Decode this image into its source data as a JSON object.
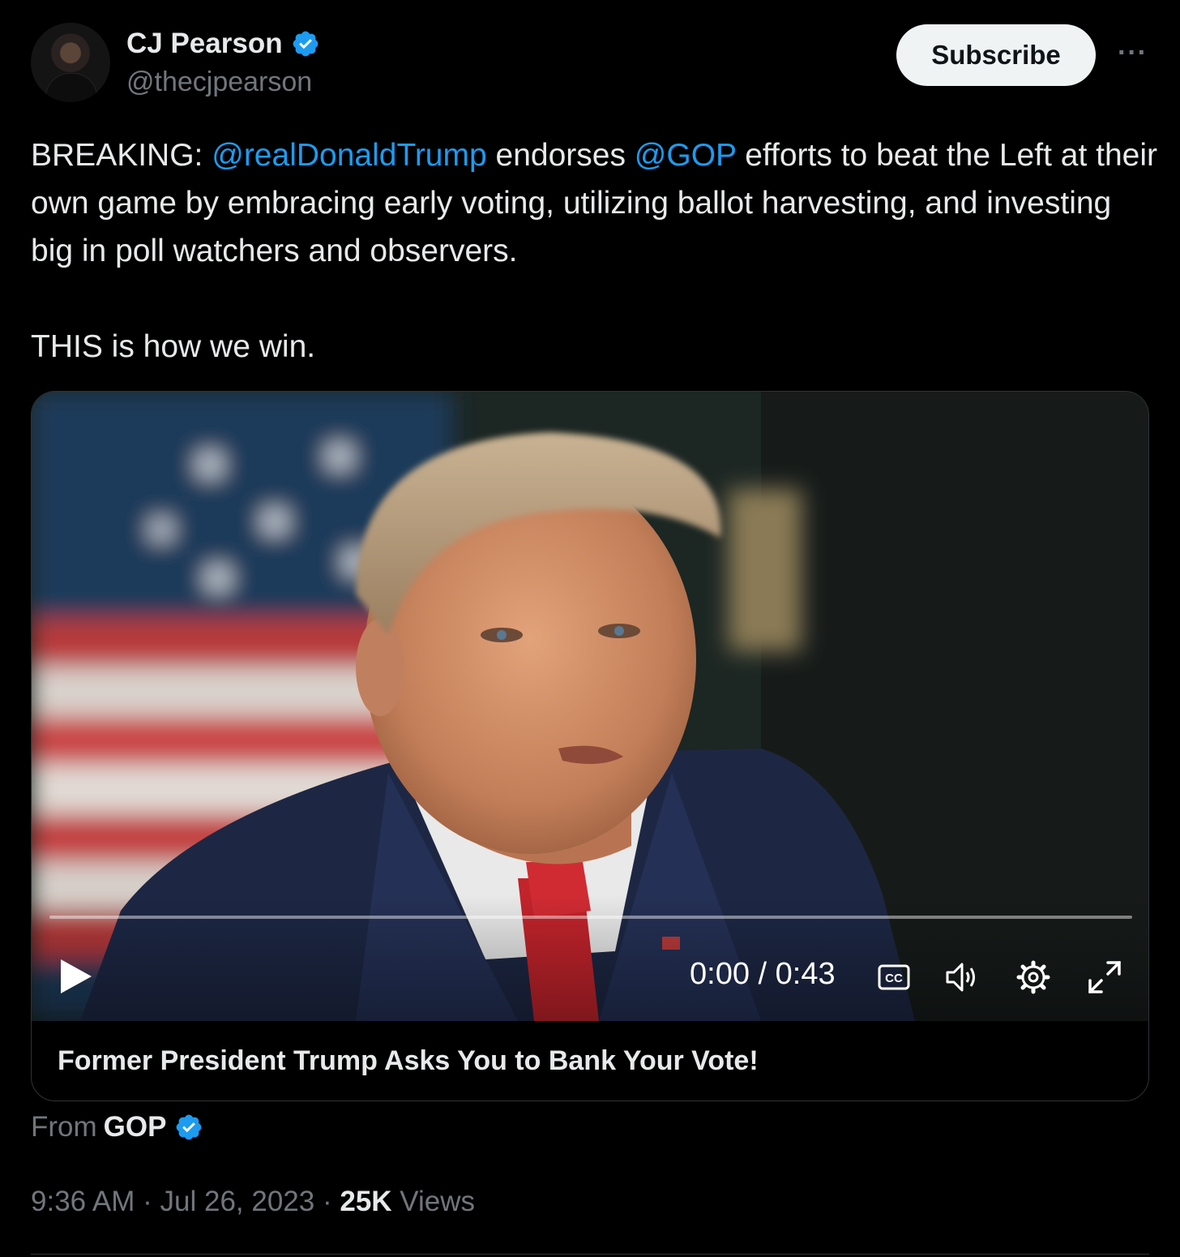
{
  "author": {
    "display_name": "CJ Pearson",
    "handle": "@thecjpearson"
  },
  "actions": {
    "subscribe_label": "Subscribe",
    "more_label": "···"
  },
  "tweet": {
    "prefix": "BREAKING: ",
    "mention_1": "@realDonaldTrump",
    "middle": " endorses ",
    "mention_2": "@GOP",
    "rest": " efforts to beat the Left at their own game by embracing early voting, utilizing ballot harvesting, and investing big in poll watchers and observers.",
    "closing": "THIS is how we win."
  },
  "video": {
    "time": "0:00 / 0:43",
    "progress": 0,
    "title": "Former President Trump Asks You to Bank Your Vote!"
  },
  "source": {
    "from_label": "From",
    "name": "GOP"
  },
  "meta": {
    "time": "9:36 AM",
    "sep1": " · ",
    "date": "Jul 26, 2023",
    "sep2": " · ",
    "views_count": "25K",
    "views_label": " Views"
  },
  "colors": {
    "accent": "#1d9bf0",
    "background": "#000000",
    "secondary_text": "#71767b"
  }
}
